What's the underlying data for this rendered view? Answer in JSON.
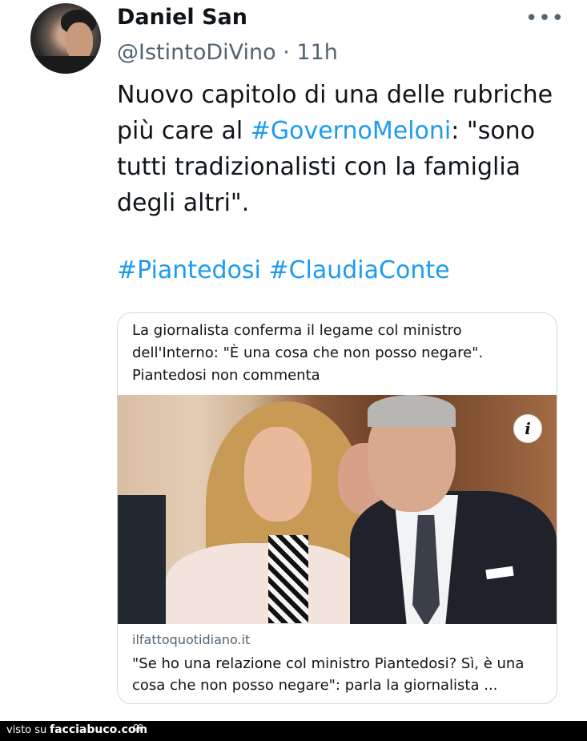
{
  "tweet": {
    "author_name": "Daniel San",
    "handle": "@IstintoDiVino",
    "separator": "·",
    "time": "11h",
    "more_icon": "more-horizontal-icon",
    "text_part1": "Nuovo capitolo di una delle rubriche più care al ",
    "text_hashtag": "#GovernoMeloni",
    "text_part2": ": \"sono tutti tradizionalisti con la famiglia degli altri\".",
    "hashtag1": "#Piantedosi",
    "hashtag2": "#ClaudiaConte"
  },
  "card": {
    "headline": "La giornalista conferma il legame col ministro dell'Interno: \"È una cosa che non posso negare\". Piantedosi non commenta",
    "info_icon": "info-icon",
    "info_label": "i",
    "domain": "ilfattoquotidiano.it",
    "title": "\"Se ho una relazione col ministro Piantedosi? Sì, è una cosa che non posso negare\": parla la giornalista ..."
  },
  "footer": {
    "visto_su": "visto su",
    "site": "facciabuco.com",
    "logo_icon": "eyes-icon",
    "logo_glyph": "ºº"
  },
  "colors": {
    "text": "#0f1419",
    "secondary": "#536471",
    "link": "#1d9bf0",
    "border": "#cfd9de"
  }
}
